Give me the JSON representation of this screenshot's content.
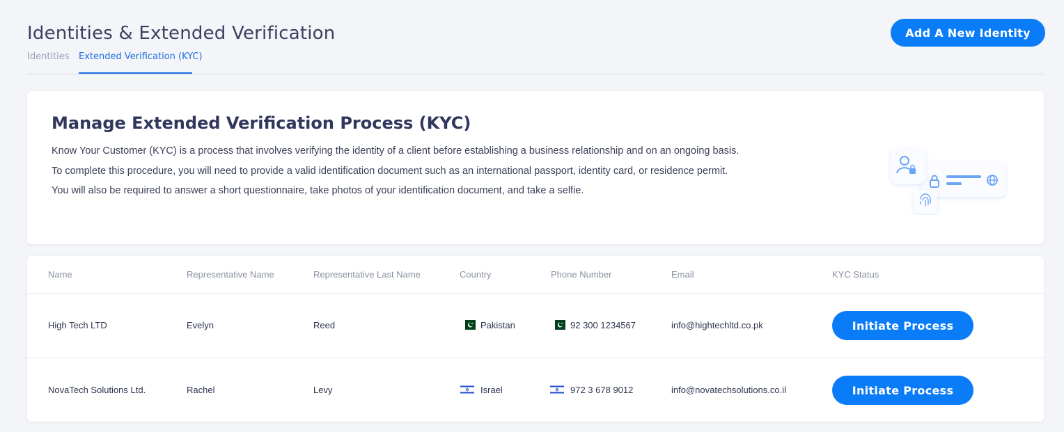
{
  "header": {
    "title": "Identities & Extended Verification",
    "add_button_label": "Add A New Identity"
  },
  "tabs": [
    {
      "label": "Identities",
      "active": false
    },
    {
      "label": "Extended Verification (KYC)",
      "active": true
    }
  ],
  "kyc_info": {
    "title": "Manage Extended Verification Process (KYC)",
    "lines": [
      "Know Your Customer (KYC) is a process that involves verifying the identity of a client before establishing a business relationship and on an ongoing basis.",
      "To complete this procedure, you will need to provide a valid identification document such as an international passport, identity card, or residence permit.",
      "You will also be required to answer a short questionnaire, take photos of your identification document, and take a selfie."
    ],
    "illustration_icons": [
      "user-lock-icon",
      "lock-icon",
      "globe-icon",
      "fingerprint-icon"
    ]
  },
  "table": {
    "columns": [
      "Name",
      "Representative Name",
      "Representative Last Name",
      "Country",
      "Phone Number",
      "Email",
      "KYC Status"
    ],
    "rows": [
      {
        "name": "High Tech LTD",
        "rep_name": "Evelyn",
        "rep_last_name": "Reed",
        "country": "Pakistan",
        "country_flag": "pakistan-flag-icon",
        "phone": "92 300 1234567",
        "phone_flag": "pakistan-flag-icon",
        "email": "info@hightechltd.co.pk",
        "status_button": "Initiate Process"
      },
      {
        "name": "NovaTech Solutions Ltd.",
        "rep_name": "Rachel",
        "rep_last_name": "Levy",
        "country": "Israel",
        "country_flag": "israel-flag-icon",
        "phone": "972 3 678 9012",
        "phone_flag": "israel-flag-icon",
        "email": "info@novatechsolutions.co.il",
        "status_button": "Initiate Process"
      }
    ]
  },
  "colors": {
    "accent": "#0a7cf7",
    "active_tab": "#1b6fe0",
    "page_bg": "#f4f5f8"
  }
}
